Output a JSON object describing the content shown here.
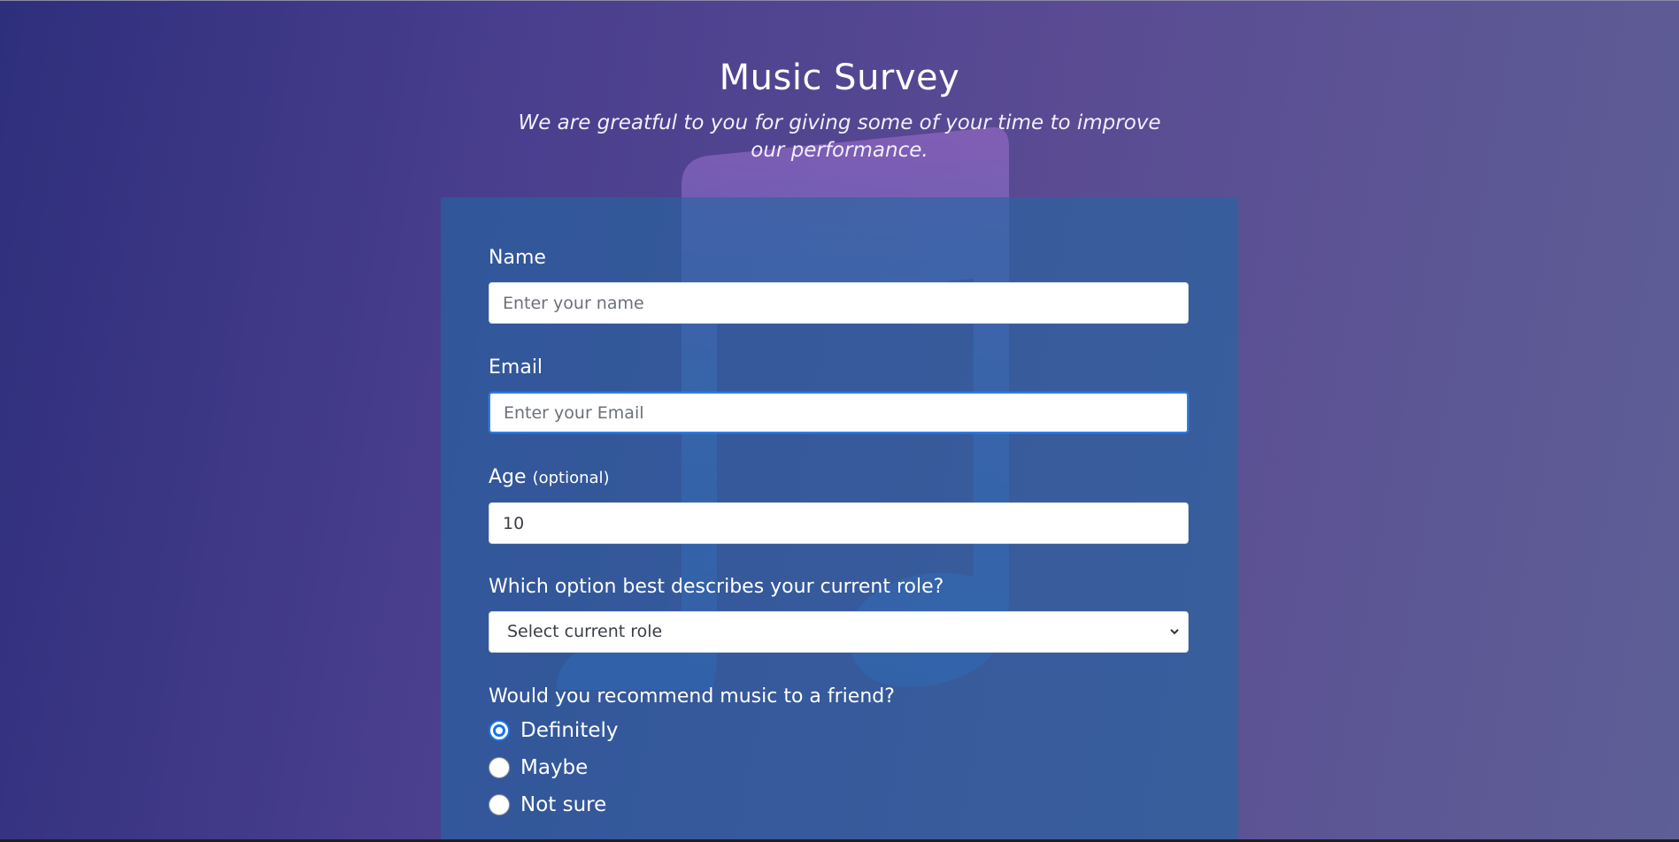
{
  "header": {
    "title": "Music Survey",
    "description": "We are greatful to you for giving some of your time to improve our performance."
  },
  "form": {
    "name": {
      "label": "Name",
      "placeholder": "Enter your name",
      "value": ""
    },
    "email": {
      "label": "Email",
      "placeholder": "Enter your Email",
      "value": ""
    },
    "age": {
      "label": "Age",
      "optional_label": "(optional)",
      "value": "10"
    },
    "role": {
      "label": "Which option best describes your current role?",
      "selected": "Select current role"
    },
    "recommend": {
      "label": "Would you recommend music to a friend?",
      "options": [
        "Definitely",
        "Maybe",
        "Not sure"
      ],
      "selected_index": 0
    }
  },
  "icons": {
    "background": "music-note-icon",
    "select": "chevron-down-icon"
  },
  "colors": {
    "panel": "#2a64a0",
    "focus_ring": "#2f7de7",
    "radio_checked": "#1a73e8"
  }
}
